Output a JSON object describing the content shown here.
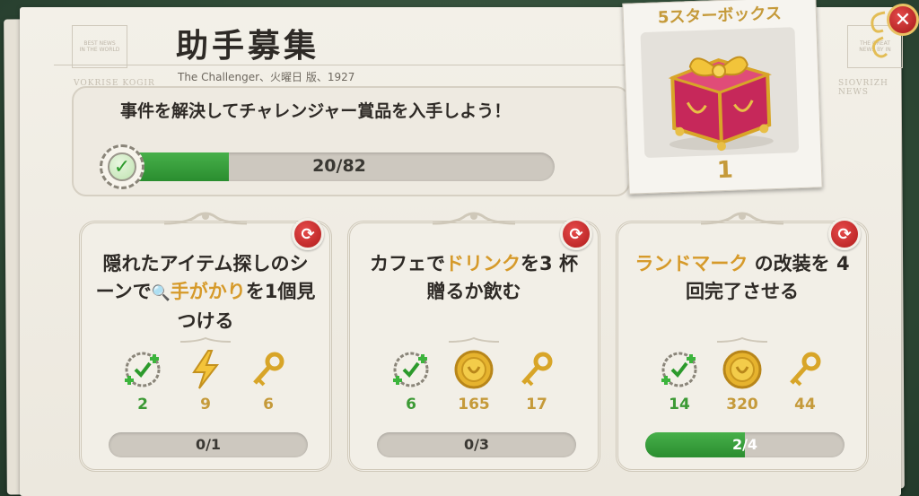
{
  "header": {
    "title": "助手募集",
    "subtitle": "The Challenger、火曜日 版、1927",
    "ghost_left": "VOKRISE KOGIR",
    "ghost_right": "SIOVRIZH NEWS"
  },
  "main_challenge": {
    "text": "事件を解決してチャレンジャー賞品を入手しよう！",
    "progress_current": 20,
    "progress_total": 82,
    "progress_label": "20/82"
  },
  "prize": {
    "title": "5スターボックス",
    "count": "1"
  },
  "colors": {
    "accent_gold": "#c59a3a",
    "progress_green": "#2a8d2f",
    "close_red": "#a51818"
  },
  "tasks": [
    {
      "text_parts": [
        "隠れたアイテム探しのシーンで",
        "手がかり",
        "を1個見つける"
      ],
      "rewards": [
        {
          "icon": "case-check-icon",
          "value": "2"
        },
        {
          "icon": "energy-bolt-icon",
          "value": "9"
        },
        {
          "icon": "key-icon",
          "value": "6"
        }
      ],
      "progress_current": 0,
      "progress_total": 1,
      "progress_label": "0/1"
    },
    {
      "text_parts": [
        "カフェで",
        "ドリンク",
        "を3 杯贈るか飲む"
      ],
      "rewards": [
        {
          "icon": "case-check-icon",
          "value": "6"
        },
        {
          "icon": "gold-coin-icon",
          "value": "165"
        },
        {
          "icon": "key-icon",
          "value": "17"
        }
      ],
      "progress_current": 0,
      "progress_total": 3,
      "progress_label": "0/3"
    },
    {
      "text_parts": [
        "ランドマーク",
        " の改装を 4 回完了させる"
      ],
      "rewards": [
        {
          "icon": "case-check-icon",
          "value": "14"
        },
        {
          "icon": "gold-coin-icon",
          "value": "320"
        },
        {
          "icon": "key-icon",
          "value": "44"
        }
      ],
      "progress_current": 2,
      "progress_total": 4,
      "progress_label": "2/4"
    }
  ]
}
